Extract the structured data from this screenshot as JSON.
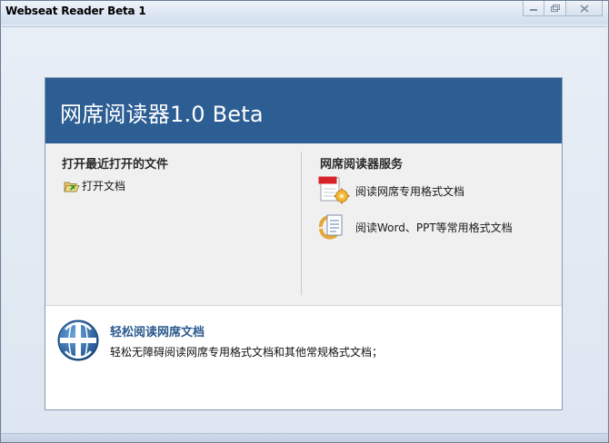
{
  "window": {
    "title": "Webseat Reader Beta 1"
  },
  "banner": {
    "title": "网席阅读器1.0 Beta"
  },
  "recent": {
    "heading": "打开最近打开的文件",
    "open_doc_label": "打开文档"
  },
  "services": {
    "heading": "网席阅读器服务",
    "items": [
      {
        "label": "阅读网席专用格式文档",
        "icon": "webseat-document-icon"
      },
      {
        "label": "阅读Word、PPT等常用格式文档",
        "icon": "office-document-icon"
      }
    ]
  },
  "feature": {
    "title": "轻松阅读网席文档",
    "description": "轻松无障碍阅读网席专用格式文档和其他常规格式文档；",
    "icon": "globe-logo-icon"
  },
  "colors": {
    "banner": "#2c5d93",
    "feature_title": "#2b5a8e"
  }
}
